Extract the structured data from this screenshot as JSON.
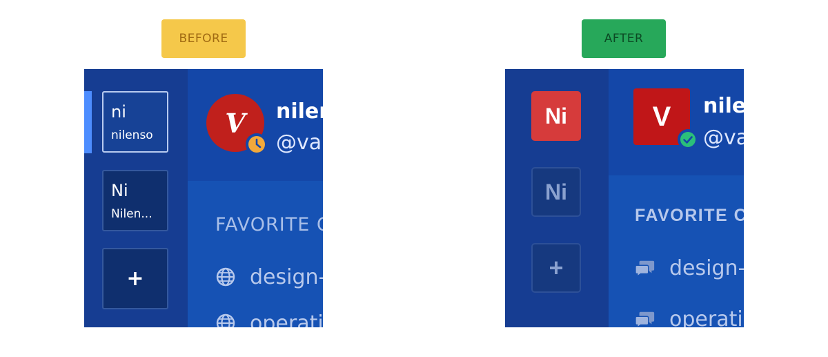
{
  "labels": {
    "before": "BEFORE",
    "after": "AFTER"
  },
  "colors": {
    "before_badge": "#f5c84a",
    "after_badge": "#27a85a",
    "rail": "#163d92",
    "main": "#1652b4",
    "avatar_red": "#c0201c",
    "status_away": "#f2a93b",
    "status_online": "#2bbf7a"
  },
  "before": {
    "teams": [
      {
        "abbr": "ni",
        "name": "nilenso"
      },
      {
        "abbr": "Ni",
        "name": "Nilen..."
      }
    ],
    "add_label": "+",
    "avatar_letter": "V",
    "status_icon": "clock-icon",
    "user_name": "nilenso",
    "user_handle": "@varun",
    "section_title": "FAVORITE CHANNELS",
    "channels": [
      {
        "icon": "globe-icon",
        "name": "design-team"
      },
      {
        "icon": "globe-icon",
        "name": "operations"
      }
    ]
  },
  "after": {
    "teams": [
      {
        "abbr": "Ni"
      },
      {
        "abbr": "Ni"
      }
    ],
    "add_label": "+",
    "avatar_letter": "V",
    "status_icon": "check-circle-icon",
    "user_name": "nilenso",
    "user_handle": "@varun",
    "section_title": "FAVORITE CHANNELS",
    "channels": [
      {
        "icon": "chat-bubbles-icon",
        "name": "design-team"
      },
      {
        "icon": "chat-bubbles-icon",
        "name": "operations"
      }
    ]
  }
}
